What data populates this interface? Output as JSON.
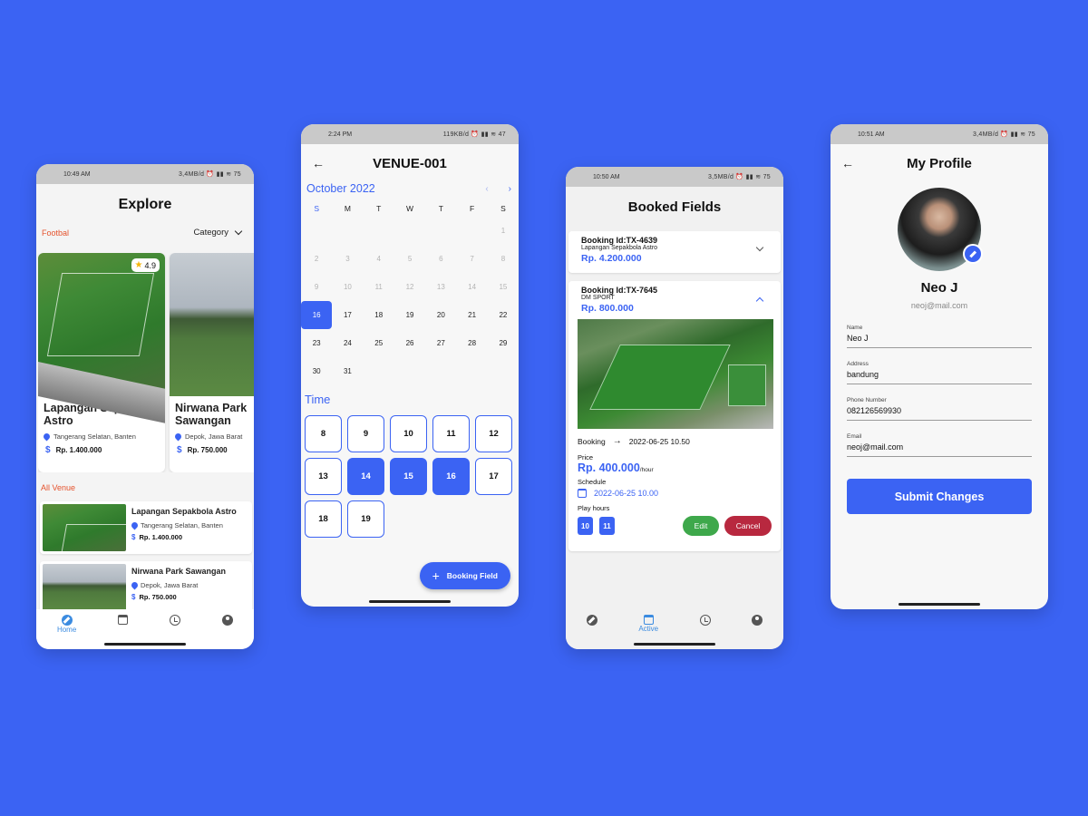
{
  "colors": {
    "background": "#3b63f3",
    "primary": "#3b63f3",
    "accent_label": "#e5532d",
    "edit_button": "#3ea84b",
    "cancel_button": "#b8283f"
  },
  "explore": {
    "status": {
      "time": "10:49 AM",
      "right": "3,4MB/d ⏰ ▮▮ ≋ 75"
    },
    "title": "Explore",
    "section_label": "Footbal",
    "category_label": "Category",
    "venues": [
      {
        "name": "Lapangan Sepakbola Astro",
        "location": "Tangerang Selatan, Banten",
        "price": "Rp. 1.400.000",
        "rating": "4.9"
      },
      {
        "name": "Nirwana Park Sawangan",
        "location": "Depok, Jawa Barat",
        "price": "Rp. 750.000"
      }
    ],
    "all_venue_label": "All Venue",
    "list": [
      {
        "name": "Lapangan Sepakbola Astro",
        "location": "Tangerang Selatan, Banten",
        "price": "Rp. 1.400.000"
      },
      {
        "name": "Nirwana Park Sawangan",
        "location": "Depok, Jawa Barat",
        "price": "Rp. 750.000"
      }
    ],
    "nav": {
      "home_label": "Home"
    }
  },
  "calendar": {
    "status": {
      "time": "2:24 PM",
      "right": "119KB/d ⏰ ▮▮ ≋ 47"
    },
    "title": "VENUE-001",
    "month": "October 2022",
    "weekdays": [
      "S",
      "M",
      "T",
      "W",
      "T",
      "F",
      "S"
    ],
    "days": [
      "1",
      "2",
      "3",
      "4",
      "5",
      "6",
      "7",
      "8",
      "9",
      "10",
      "11",
      "12",
      "13",
      "14",
      "15",
      "16",
      "17",
      "18",
      "19",
      "20",
      "21",
      "22",
      "23",
      "24",
      "25",
      "26",
      "27",
      "28",
      "29",
      "30",
      "31"
    ],
    "selected_day": "16",
    "time_label": "Time",
    "hours": [
      "8",
      "9",
      "10",
      "11",
      "12",
      "13",
      "14",
      "15",
      "16",
      "17",
      "18",
      "19"
    ],
    "selected_hours": [
      "14",
      "15",
      "16"
    ],
    "fab_label": "Booking Field"
  },
  "booked": {
    "status": {
      "time": "10:50 AM",
      "right": "3,5MB/d ⏰ ▮▮ ≋ 75"
    },
    "title": "Booked Fields",
    "bookings": [
      {
        "id": "Booking Id:TX-4639",
        "venue": "Lapangan Sepakbola Astro",
        "price": "Rp. 4.200.000"
      },
      {
        "id": "Booking Id:TX-7645",
        "venue": "DM SPORT",
        "price": "Rp. 800.000"
      }
    ],
    "detail": {
      "booking_label": "Booking",
      "booking_datetime": "2022-06-25 10.50",
      "price_label": "Price",
      "price_value": "Rp. 400.000",
      "price_unit": "/hour",
      "schedule_label": "Schedule",
      "schedule_value": "2022-06-25 10.00",
      "play_hours_label": "Play hours",
      "play_hours": [
        "10",
        "11"
      ],
      "edit_label": "Edit",
      "cancel_label": "Cancel"
    },
    "nav": {
      "active_label": "Active"
    }
  },
  "profile": {
    "status": {
      "time": "10:51 AM",
      "right": "3,4MB/d ⏰ ▮▮ ≋ 75"
    },
    "title": "My Profile",
    "name": "Neo J",
    "email": "neoj@mail.com",
    "fields": [
      {
        "label": "Name",
        "value": "Neo J"
      },
      {
        "label": "Address",
        "value": "bandung"
      },
      {
        "label": "Phone Number",
        "value": "082126569930"
      },
      {
        "label": "Email",
        "value": "neoj@mail.com"
      }
    ],
    "submit_label": "Submit Changes"
  }
}
